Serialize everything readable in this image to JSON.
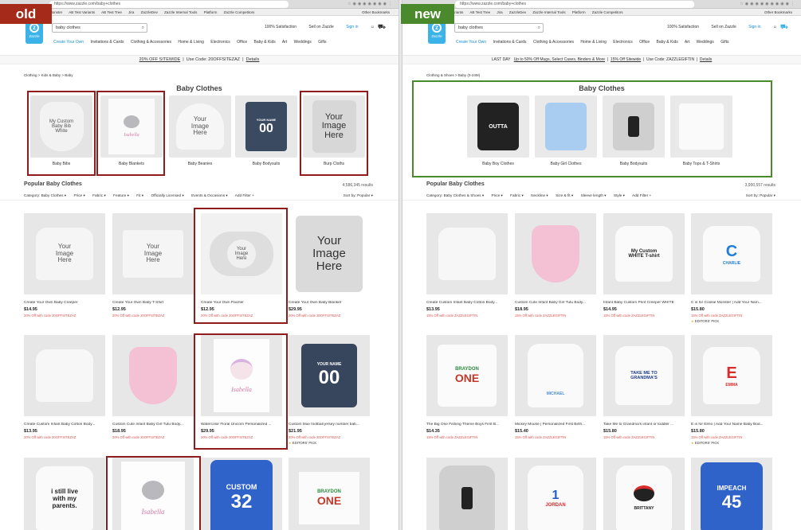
{
  "labels": {
    "old": "old",
    "new": "new"
  },
  "colors": {
    "old_tag": "#a52a1a",
    "new_tag": "#4b8a2c",
    "highlight_old": "#8e1c1c",
    "highlight_new": "#4a8a2a",
    "link": "#1a8fd2",
    "discount": "#d9534f"
  },
  "old": {
    "url": "https://www.zazzle.com/baby+clothes",
    "bookmarks": [
      "Monster",
      "AB Test Variants",
      "AB Test Tree",
      "Jira",
      "ZazzleDev",
      "Zazzle Internal Tools",
      "Platform",
      "Zazzle Competitors"
    ],
    "other_bookmarks": "Other Bookmarks",
    "search_value": "baby clothes",
    "logo_text": "Zazzle",
    "header_links": {
      "satisfaction": "100% Satisfaction",
      "sell": "Sell on Zazzle",
      "signin": "Sign in"
    },
    "nav": [
      "Create Your Own",
      "Invitations & Cards",
      "Clothing & Accessories",
      "Home & Living",
      "Electronics",
      "Office",
      "Baby & Kids",
      "Art",
      "Weddings",
      "Gifts"
    ],
    "promo": {
      "offer": "20% OFF SITEWIDE",
      "code": "Use Code: 20OFFSITEZAZ",
      "details": "Details"
    },
    "breadcrumb": "Clothing  >  Kids & Baby  >  Baby",
    "title": "Baby Clothes",
    "categories": [
      "Baby Bibs",
      "Baby Blankets",
      "Baby Beanies",
      "Baby Bodysuits",
      "Burp Cloths"
    ],
    "popular_title": "Popular Baby Clothes",
    "results": "4,586,345 results",
    "filters": [
      "Category: Baby Clothes ▾",
      "Price ▾",
      "Fabric ▾",
      "Feature ▾",
      "Fit ▾",
      "Officially Licensed ▾",
      "Events & Occasions ▾",
      "Add Filter +"
    ],
    "sort": "Sort by:  Popular ▾",
    "img_text": {
      "your_image_here": "Your Image Here",
      "bib": "My Custom Baby Bib White",
      "isabella": "Isabella",
      "your_name": "YOUR NAME",
      "number00": "00",
      "i_still_live": "i still live with my parents.",
      "custom": "CUSTOM",
      "number32": "32",
      "braydon": "BRAYDON",
      "one": "ONE"
    },
    "products": [
      {
        "name": "Create Your Own Baby Creeper",
        "price": "$14.95",
        "discount": "20% Off with code 20OFFSITEZAZ"
      },
      {
        "name": "Create Your Own Baby T-Shirt",
        "price": "$12.95",
        "discount": "20% Off with code 20OFFSITEZAZ"
      },
      {
        "name": "Create Your Own Pacifier",
        "price": "$12.95",
        "discount": "20% Off with code 20OFFSITEZAZ"
      },
      {
        "name": "Create Your Own Baby Blanket",
        "price": "$29.95",
        "discount": "20% Off with code 20OFFSITEZAZ"
      },
      {
        "name": "Create Custom Infant Baby Cotton Body...",
        "price": "$13.95",
        "discount": "20% Off with code 20OFFSITEZAZ"
      },
      {
        "name": "Custom Cute Infant Baby Girl Tutu Body...",
        "price": "$18.95",
        "discount": "20% Off with code 20OFFSITEZAZ"
      },
      {
        "name": "Watercolor Floral Unicorn Personalized ...",
        "price": "$29.95",
        "discount": "20% Off with code 20OFFSITEZAZ"
      },
      {
        "name": "Custom blue football jersey number bab...",
        "price": "$21.95",
        "discount": "20% Off with code 20OFFSITEZAZ",
        "editors": "EDITORS' PICK"
      }
    ]
  },
  "new": {
    "url": "https://www.zazzle.com/baby+clothes",
    "bookmarks": [
      "Cookie Monster",
      "AB Test Variants",
      "AB Test Tree",
      "Jira",
      "ZazzleDev",
      "Zazzle Internal Tools",
      "Platform",
      "Zazzle Competitors"
    ],
    "other_bookmarks": "Other Bookmarks",
    "search_value": "baby clothes",
    "logo_text": "Zazzle",
    "header_links": {
      "satisfaction": "100% Satisfaction",
      "sell": "Sell on Zazzle",
      "signin": "Sign in"
    },
    "nav": [
      "Create Your Own",
      "Invitations & Cards",
      "Clothing & Accessories",
      "Home & Living",
      "Electronics",
      "Office",
      "Baby & Kids",
      "Art",
      "Weddings",
      "Gifts"
    ],
    "promo": {
      "lastday": "LAST DAY",
      "offer": "Up to 50% Off Mugs, Select Cases, Binders & More",
      "offer2": "15% Off Sitewide",
      "code": "Use Code: ZAZZLEGIFTIN",
      "details": "Details"
    },
    "breadcrumb": "Clothing & Shoes  >  Baby (0-24M)",
    "title": "Baby Clothes",
    "categories": [
      "Baby Boy Clothes",
      "Baby Girl Clothes",
      "Baby Bodysuits",
      "Baby Tops & T-Shirts"
    ],
    "popular_title": "Popular Baby Clothes",
    "results": "3,900,557 results",
    "filters": [
      "Category: Baby Clothes & Shoes ▾",
      "Price ▾",
      "Fabric ▾",
      "Neckline ▾",
      "Size & fit ▾",
      "Sleeve length ▾",
      "Style ▾",
      "Add Filter +"
    ],
    "sort": "Sort by:  Popular ▾",
    "img_text": {
      "outta": "OUTTA",
      "white_tshirt": "My Custom WHITE T-shirt",
      "letter_c": "C",
      "charlie": "CHARLIE",
      "letter_e": "E",
      "emma": "EMMA",
      "braydon": "BRAYDON",
      "one": "ONE",
      "michael": "MICHAEL",
      "grandmas": "TAKE ME TO GRANDMA'S",
      "jordan": "JORDAN",
      "number1": "1",
      "brittany": "BRITTANY",
      "impeach": "IMPEACH",
      "number45": "45"
    },
    "products": [
      {
        "name": "Create Custom Infant Baby Cotton Body...",
        "price": "$13.95",
        "discount": "15% Off with code ZAZZLEGIFTIN"
      },
      {
        "name": "Custom Cute Infant Baby Girl Tutu Body...",
        "price": "$18.95",
        "discount": "15% Off with code ZAZZLEGIFTIN"
      },
      {
        "name": "Infant Baby Custom Print Creeper WHITE",
        "price": "$14.95",
        "discount": "15% Off with code ZAZZLEGIFTIN"
      },
      {
        "name": "C is for Cookie Monster | Add Your Nam...",
        "price": "$15.80",
        "discount": "15% Off with code ZAZZLEGIFTIN",
        "editors": "EDITORS' PICK"
      },
      {
        "name": "The Big One Fishing Theme Boys First B...",
        "price": "$14.35",
        "discount": "15% Off with code ZAZZLEGIFTIN"
      },
      {
        "name": "Mickey Mouse | Personalized First Birth...",
        "price": "$15.40",
        "discount": "15% Off with code ZAZZLEGIFTIN"
      },
      {
        "name": "Take Me to Grandma's infant or toddler ...",
        "price": "$15.80",
        "discount": "15% Off with code ZAZZLEGIFTIN"
      },
      {
        "name": "E is for Elmo | Add Your Name Baby Bod...",
        "price": "$15.80",
        "discount": "15% Off with code ZAZZLEGIFTIN",
        "editors": "EDITORS' PICK"
      }
    ]
  }
}
